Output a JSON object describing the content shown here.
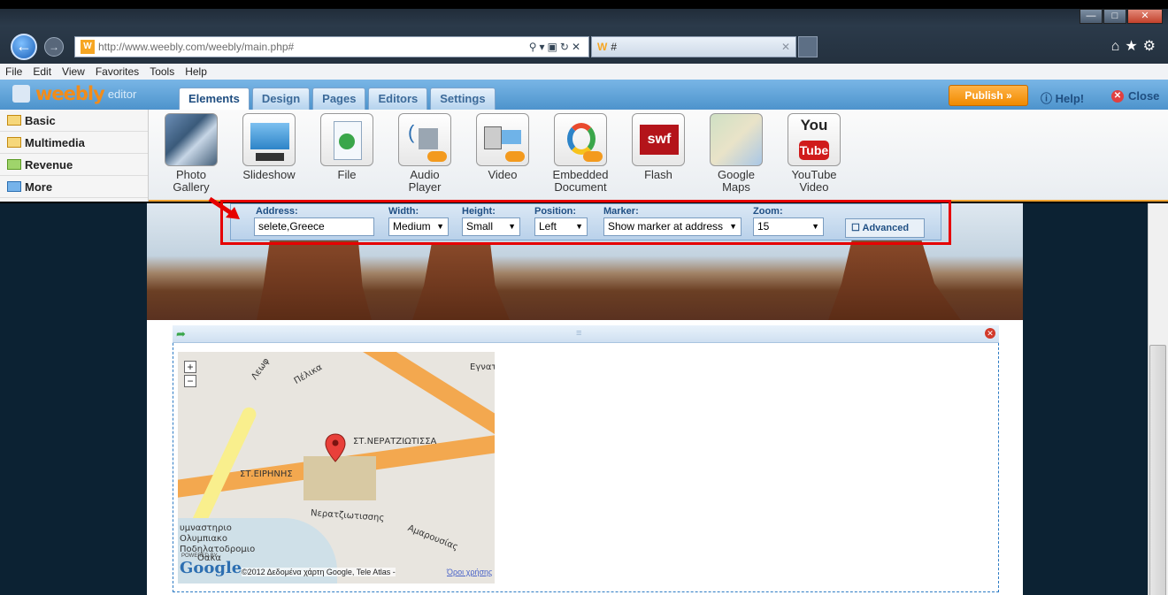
{
  "browser": {
    "url": "http://www.weebly.com/weebly/main.php#",
    "tab_title": "#",
    "favicon": "W",
    "menu": [
      "File",
      "Edit",
      "View",
      "Favorites",
      "Tools",
      "Help"
    ],
    "window_buttons": [
      "minimize",
      "maximize",
      "close"
    ]
  },
  "weebly": {
    "logo": "weebly",
    "logo_sub": "editor",
    "tabs": [
      "Elements",
      "Design",
      "Pages",
      "Editors",
      "Settings"
    ],
    "active_tab": "Elements",
    "publish_label": "Publish »",
    "help_label": "Help!",
    "close_label": "Close"
  },
  "categories": [
    "Basic",
    "Multimedia",
    "Revenue",
    "More"
  ],
  "elements": [
    {
      "line1": "Photo",
      "line2": "Gallery",
      "icon": "photo-gallery-icon"
    },
    {
      "line1": "Slideshow",
      "line2": "",
      "icon": "slideshow-icon"
    },
    {
      "line1": "File",
      "line2": "",
      "icon": "file-icon"
    },
    {
      "line1": "Audio",
      "line2": "Player",
      "icon": "audio-player-icon"
    },
    {
      "line1": "Video",
      "line2": "",
      "icon": "video-icon"
    },
    {
      "line1": "Embedded",
      "line2": "Document",
      "icon": "embedded-document-icon"
    },
    {
      "line1": "Flash",
      "line2": "",
      "icon": "flash-icon",
      "badge": "swf"
    },
    {
      "line1": "Google",
      "line2": "Maps",
      "icon": "google-maps-icon"
    },
    {
      "line1": "YouTube",
      "line2": "Video",
      "icon": "youtube-icon",
      "badge_top": "You",
      "badge_bottom": "Tube"
    }
  ],
  "map_settings": {
    "address_label": "Address:",
    "address_value": "selete,Greece",
    "width_label": "Width:",
    "width_value": "Medium",
    "height_label": "Height:",
    "height_value": "Small",
    "position_label": "Position:",
    "position_value": "Left",
    "marker_label": "Marker:",
    "marker_value": "Show marker at address",
    "zoom_label": "Zoom:",
    "zoom_value": "15",
    "advanced_label": "Advanced"
  },
  "map": {
    "labels": [
      "ΣΤ.ΝΕΡΑΤΖΙΩΤΙΣΣΑ",
      "ΣΤ.ΕΙΡΗΝΗΣ",
      "Νερατζιωτισσης",
      "Αμαρουσίας",
      "Εγνατ",
      "Πέλικα",
      "Λεωφ",
      "υμναστηριο",
      "Ολυμπιακο",
      "Ποδηλατοδρομιο",
      "Οακα"
    ],
    "copyright": "©2012 Δεδομένα χάρτη Google, Tele Atlas -",
    "terms": "Όροι χρήσης",
    "powered": "POWERED BY",
    "google": "Google",
    "zoom_in": "+",
    "zoom_out": "−"
  },
  "colors": {
    "accent_orange": "#f0a330",
    "weebly_blue": "#4d93cc",
    "highlight_red": "#e60000",
    "publish_orange": "#f08a00"
  }
}
